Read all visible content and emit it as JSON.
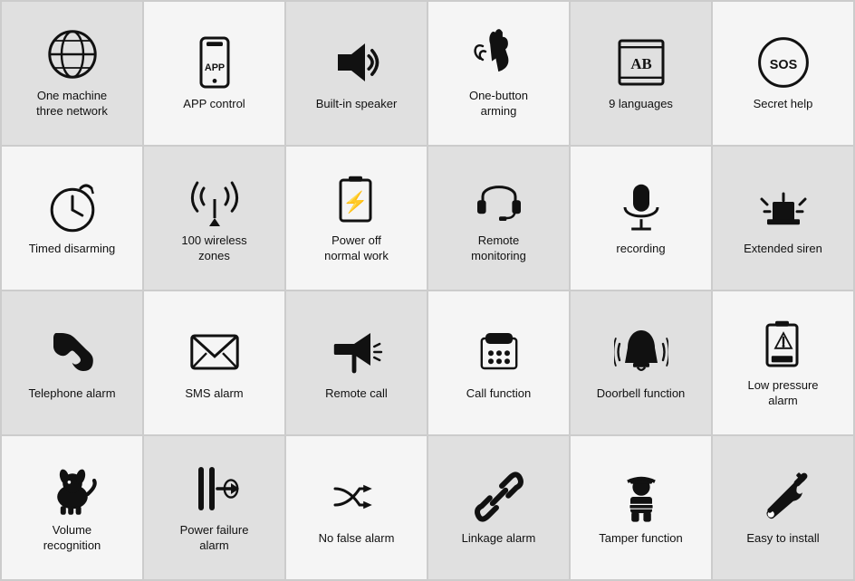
{
  "cells": [
    {
      "id": "one-machine",
      "label": "One machine\nthree network",
      "icon": "globe",
      "shade": "dark"
    },
    {
      "id": "app-control",
      "label": "APP control",
      "icon": "phone",
      "shade": "light"
    },
    {
      "id": "speaker",
      "label": "Built-in speaker",
      "icon": "speaker",
      "shade": "dark"
    },
    {
      "id": "one-button",
      "label": "One-button\narming",
      "icon": "touch",
      "shade": "light"
    },
    {
      "id": "languages",
      "label": "9 languages",
      "icon": "book",
      "shade": "dark"
    },
    {
      "id": "sos",
      "label": "Secret help",
      "icon": "sos",
      "shade": "light"
    },
    {
      "id": "timed",
      "label": "Timed disarming",
      "icon": "clock",
      "shade": "light"
    },
    {
      "id": "wireless",
      "label": "100 wireless\nzones",
      "icon": "wireless",
      "shade": "dark"
    },
    {
      "id": "poweroff",
      "label": "Power off\nnormal work",
      "icon": "battery-charge",
      "shade": "light"
    },
    {
      "id": "remote-monitor",
      "label": "Remote\nmonitoring",
      "icon": "headset",
      "shade": "dark"
    },
    {
      "id": "recording",
      "label": "recording",
      "icon": "mic",
      "shade": "light"
    },
    {
      "id": "siren",
      "label": "Extended siren",
      "icon": "siren",
      "shade": "dark"
    },
    {
      "id": "telephone",
      "label": "Telephone alarm",
      "icon": "phone-old",
      "shade": "dark"
    },
    {
      "id": "sms",
      "label": "SMS alarm",
      "icon": "envelope",
      "shade": "light"
    },
    {
      "id": "remote-call",
      "label": "Remote call",
      "icon": "megaphone",
      "shade": "dark"
    },
    {
      "id": "call",
      "label": "Call function",
      "icon": "telephone",
      "shade": "light"
    },
    {
      "id": "doorbell",
      "label": "Doorbell function",
      "icon": "bell-ring",
      "shade": "dark"
    },
    {
      "id": "low-pressure",
      "label": "Low pressure\nalarm",
      "icon": "battery-low",
      "shade": "light"
    },
    {
      "id": "volume",
      "label": "Volume\nrecognition",
      "icon": "dog",
      "shade": "light"
    },
    {
      "id": "power-failure",
      "label": "Power failure\nalarm",
      "icon": "power-fail",
      "shade": "dark"
    },
    {
      "id": "no-false",
      "label": "No false alarm",
      "icon": "shuffle",
      "shade": "light"
    },
    {
      "id": "linkage",
      "label": "Linkage alarm",
      "icon": "chain",
      "shade": "dark"
    },
    {
      "id": "tamper",
      "label": "Tamper function",
      "icon": "worker",
      "shade": "light"
    },
    {
      "id": "easy-install",
      "label": "Easy to install",
      "icon": "wrench",
      "shade": "dark"
    }
  ]
}
